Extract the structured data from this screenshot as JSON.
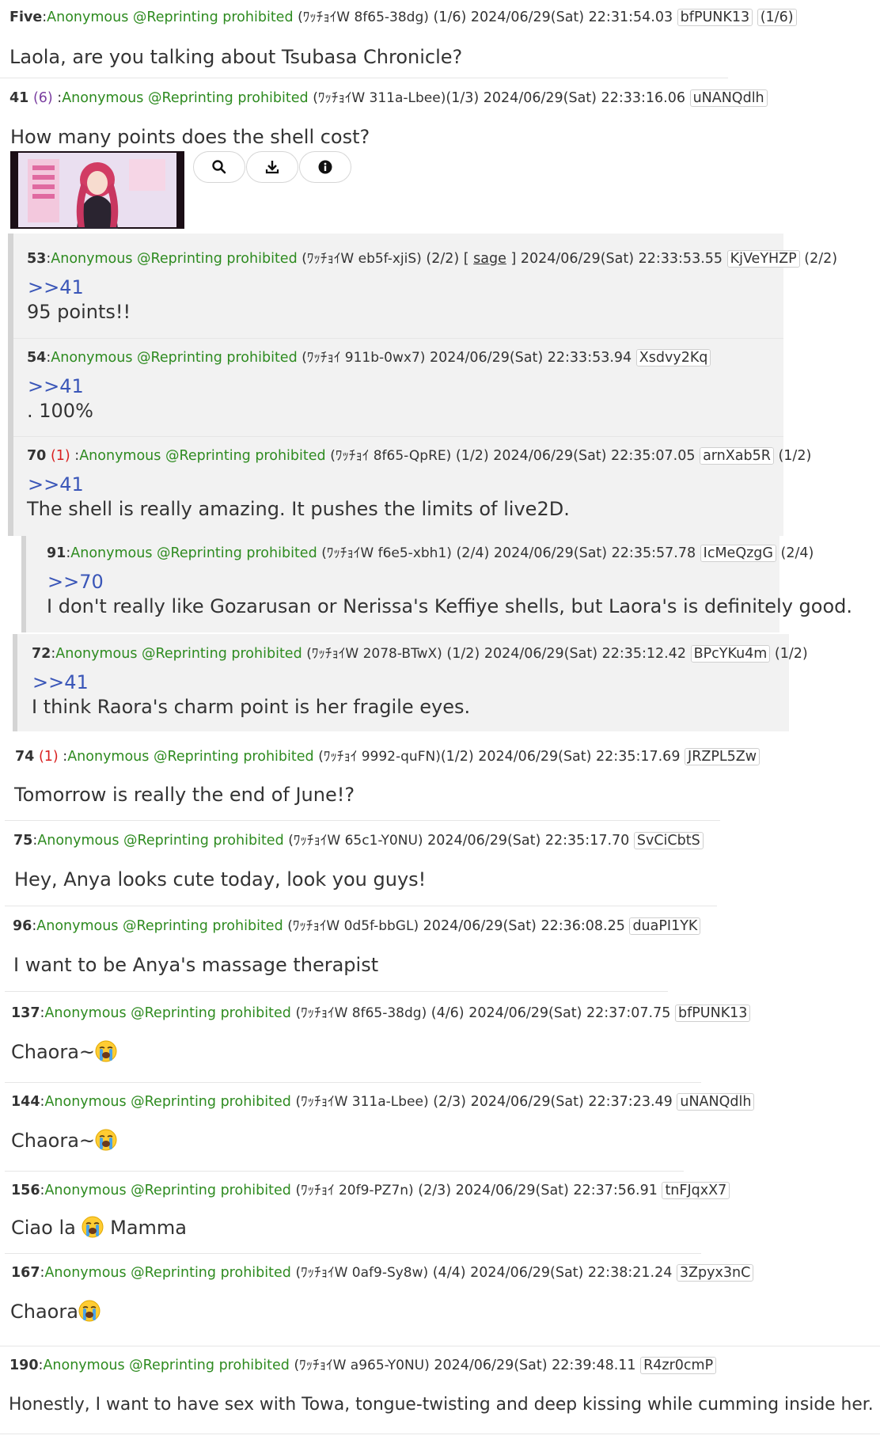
{
  "posts": [
    {
      "num": "Five",
      "reps": "",
      "name": "Anonymous @Reprinting prohibited",
      "kote": "(ﾜｯﾁｮｲW 8f65-38dg)",
      "count": "(1/6)",
      "sage": "",
      "date": "2024/06/29(Sat) 22:31:54.03",
      "id": "bfPUNK13",
      "id_count": "(1/6)",
      "anchor": "",
      "body": "Laola, are you talking about Tsubasa Chronicle?"
    },
    {
      "num": "41",
      "reps": "(6)",
      "name": "Anonymous @Reprinting prohibited",
      "kote": "(ﾜｯﾁｮｲW 311a-Lbee)",
      "count": "(1/3)",
      "sage": "",
      "date": "2024/06/29(Sat) 22:33:16.06",
      "id": "uNANQdlh",
      "id_count": "",
      "anchor": "",
      "body": "How many points does the shell cost?"
    },
    {
      "num": "53",
      "reps": "",
      "name": "Anonymous @Reprinting prohibited",
      "kote": "(ﾜｯﾁｮｲW eb5f-xjiS)",
      "count": "(2/2)",
      "sage": "sage",
      "date": "2024/06/29(Sat) 22:33:53.55",
      "id": "KjVeYHZP",
      "id_count": "(2/2)",
      "anchor": ">>41",
      "body": "95 points!!"
    },
    {
      "num": "54",
      "reps": "",
      "name": "Anonymous @Reprinting prohibited",
      "kote": "(ﾜｯﾁｮｲ 911b-0wx7)",
      "count": "",
      "sage": "",
      "date": "2024/06/29(Sat) 22:33:53.94",
      "id": "Xsdvy2Kq",
      "id_count": "",
      "anchor": ">>41",
      "body": ". 100%"
    },
    {
      "num": "70",
      "reps": "(1)",
      "name": "Anonymous @Reprinting prohibited",
      "kote": "(ﾜｯﾁｮｲ 8f65-QpRE)",
      "count": "(1/2)",
      "sage": "",
      "date": "2024/06/29(Sat) 22:35:07.05",
      "id": "arnXab5R",
      "id_count": "(1/2)",
      "anchor": ">>41",
      "body": "The shell is really amazing. It pushes the limits of live2D."
    },
    {
      "num": "91",
      "reps": "",
      "name": "Anonymous @Reprinting prohibited",
      "kote": "(ﾜｯﾁｮｲW f6e5-xbh1)",
      "count": "(2/4)",
      "sage": "",
      "date": "2024/06/29(Sat) 22:35:57.78",
      "id": "IcMeQzgG",
      "id_count": "(2/4)",
      "anchor": ">>70",
      "body": "I don't really like Gozarusan or Nerissa's Keffiye shells, but Laora's is definitely good."
    },
    {
      "num": "72",
      "reps": "",
      "name": "Anonymous @Reprinting prohibited",
      "kote": "(ﾜｯﾁｮｲW 2078-BTwX)",
      "count": "(1/2)",
      "sage": "",
      "date": "2024/06/29(Sat) 22:35:12.42",
      "id": "BPcYKu4m",
      "id_count": "(1/2)",
      "anchor": ">>41",
      "body": "I think Raora's charm point is her fragile eyes."
    },
    {
      "num": "74",
      "reps": "(1)",
      "name": "Anonymous @Reprinting prohibited",
      "kote": "(ﾜｯﾁｮｲ 9992-quFN)",
      "count": "(1/2)",
      "sage": "",
      "date": "2024/06/29(Sat) 22:35:17.69",
      "id": "JRZPL5Zw",
      "id_count": "",
      "anchor": "",
      "body": "Tomorrow is really the end of June!?"
    },
    {
      "num": "75",
      "reps": "",
      "name": "Anonymous @Reprinting prohibited",
      "kote": "(ﾜｯﾁｮｲW 65c1-Y0NU)",
      "count": "",
      "sage": "",
      "date": "2024/06/29(Sat) 22:35:17.70",
      "id": "SvCiCbtS",
      "id_count": "",
      "anchor": "",
      "body": "Hey, Anya looks cute today, look you guys!"
    },
    {
      "num": "96",
      "reps": "",
      "name": "Anonymous @Reprinting prohibited",
      "kote": "(ﾜｯﾁｮｲW 0d5f-bbGL)",
      "count": "",
      "sage": "",
      "date": "2024/06/29(Sat) 22:36:08.25",
      "id": "duaPI1YK",
      "id_count": "",
      "anchor": "",
      "body": "I want to be Anya's massage therapist"
    },
    {
      "num": "137",
      "reps": "",
      "name": "Anonymous @Reprinting prohibited",
      "kote": "(ﾜｯﾁｮｲW 8f65-38dg)",
      "count": "(4/6)",
      "sage": "",
      "date": "2024/06/29(Sat) 22:37:07.75",
      "id": "bfPUNK13",
      "id_count": "",
      "anchor": "",
      "body": "Chaora~",
      "emoji_pos": "end"
    },
    {
      "num": "144",
      "reps": "",
      "name": "Anonymous @Reprinting prohibited",
      "kote": "(ﾜｯﾁｮｲW 311a-Lbee)",
      "count": "(2/3)",
      "sage": "",
      "date": "2024/06/29(Sat) 22:37:23.49",
      "id": "uNANQdlh",
      "id_count": "",
      "anchor": "",
      "body": "Chaora~",
      "emoji_pos": "end"
    },
    {
      "num": "156",
      "reps": "",
      "name": "Anonymous @Reprinting prohibited",
      "kote": "(ﾜｯﾁｮｲ 20f9-PZ7n)",
      "count": "(2/3)",
      "sage": "",
      "date": "2024/06/29(Sat) 22:37:56.91",
      "id": "tnFJqxX7",
      "id_count": "",
      "anchor": "",
      "body": "Ciao la",
      "body_after": "Mamma",
      "emoji_pos": "middle"
    },
    {
      "num": "167",
      "reps": "",
      "name": "Anonymous @Reprinting prohibited",
      "kote": "(ﾜｯﾁｮｲW 0af9-Sy8w)",
      "count": "(4/4)",
      "sage": "",
      "date": "2024/06/29(Sat) 22:38:21.24",
      "id": "3Zpyx3nC",
      "id_count": "",
      "anchor": "",
      "body": "Chaora",
      "emoji_pos": "end"
    },
    {
      "num": "190",
      "reps": "",
      "name": "Anonymous @Reprinting prohibited",
      "kote": "(ﾜｯﾁｮｲW a965-Y0NU)",
      "count": "",
      "sage": "",
      "date": "2024/06/29(Sat) 22:39:48.11",
      "id": "R4zr0cmP",
      "id_count": "",
      "anchor": "",
      "body": "Honestly, I want to have sex with Towa, tongue-twisting and deep kissing while cumming inside her."
    }
  ],
  "image_actions": [
    "search-icon",
    "download-icon",
    "info-icon"
  ],
  "colors": {
    "name": "#2e8b20",
    "anchor": "#3a56b8",
    "reps": "#7a3ea0",
    "reps_red": "#d92020",
    "quote_bg": "#f2f2f2",
    "quote_bar": "#d4d4d4"
  }
}
